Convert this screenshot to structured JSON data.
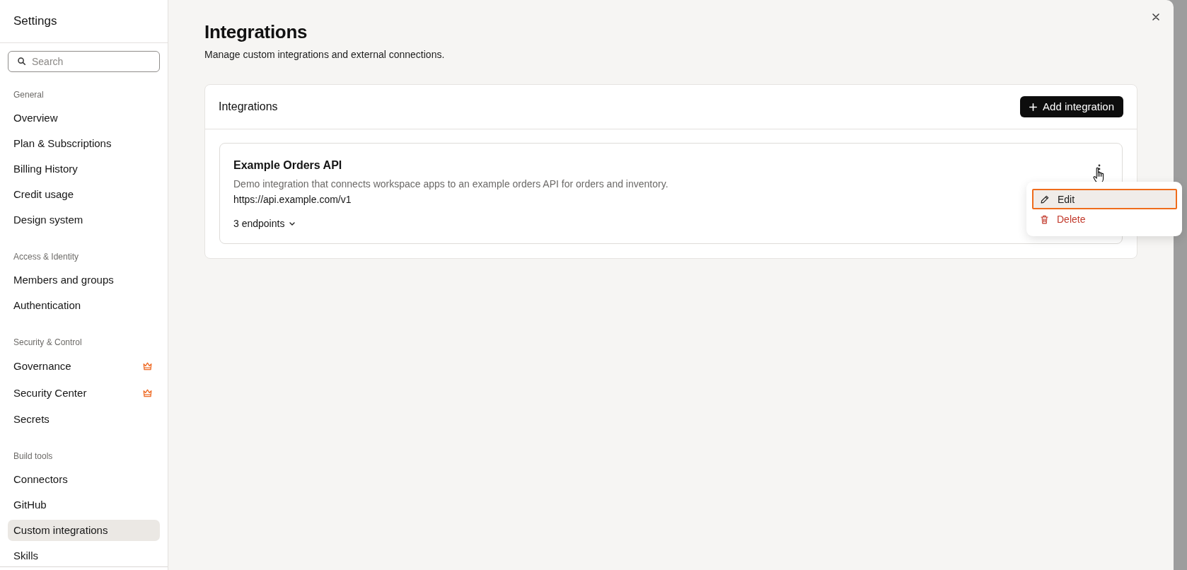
{
  "sidebar": {
    "title": "Settings",
    "search": {
      "placeholder": "Search"
    },
    "sections": [
      {
        "heading": "General",
        "items": [
          {
            "label": "Overview",
            "selected": false,
            "premium": false
          },
          {
            "label": "Plan & Subscriptions",
            "selected": false,
            "premium": false
          },
          {
            "label": "Billing History",
            "selected": false,
            "premium": false
          },
          {
            "label": "Credit usage",
            "selected": false,
            "premium": false
          },
          {
            "label": "Design system",
            "selected": false,
            "premium": false
          }
        ]
      },
      {
        "heading": "Access & Identity",
        "items": [
          {
            "label": "Members and groups",
            "selected": false,
            "premium": false
          },
          {
            "label": "Authentication",
            "selected": false,
            "premium": false
          }
        ]
      },
      {
        "heading": "Security & Control",
        "items": [
          {
            "label": "Governance",
            "selected": false,
            "premium": true
          },
          {
            "label": "Security Center",
            "selected": false,
            "premium": true
          },
          {
            "label": "Secrets",
            "selected": false,
            "premium": false
          }
        ]
      },
      {
        "heading": "Build tools",
        "items": [
          {
            "label": "Connectors",
            "selected": false,
            "premium": false
          },
          {
            "label": "GitHub",
            "selected": false,
            "premium": false
          },
          {
            "label": "Custom integrations",
            "selected": true,
            "premium": false
          },
          {
            "label": "Skills",
            "selected": false,
            "premium": false
          }
        ]
      }
    ]
  },
  "page": {
    "title": "Integrations",
    "subtitle": "Manage custom integrations and external connections."
  },
  "panel": {
    "title": "Integrations",
    "add_button": {
      "label": "Add integration"
    },
    "integrations": [
      {
        "name": "Example Orders API",
        "description": "Demo integration that connects workspace apps to an example orders API for orders and inventory.",
        "url": "https://api.example.com/v1",
        "endpoints": {
          "label": "3 endpoints",
          "expanded": false
        },
        "menu": {
          "items": [
            {
              "kind": "edit",
              "label": "Edit",
              "selected": true
            },
            {
              "kind": "delete",
              "label": "Delete",
              "selected": false
            }
          ]
        }
      }
    ]
  }
}
